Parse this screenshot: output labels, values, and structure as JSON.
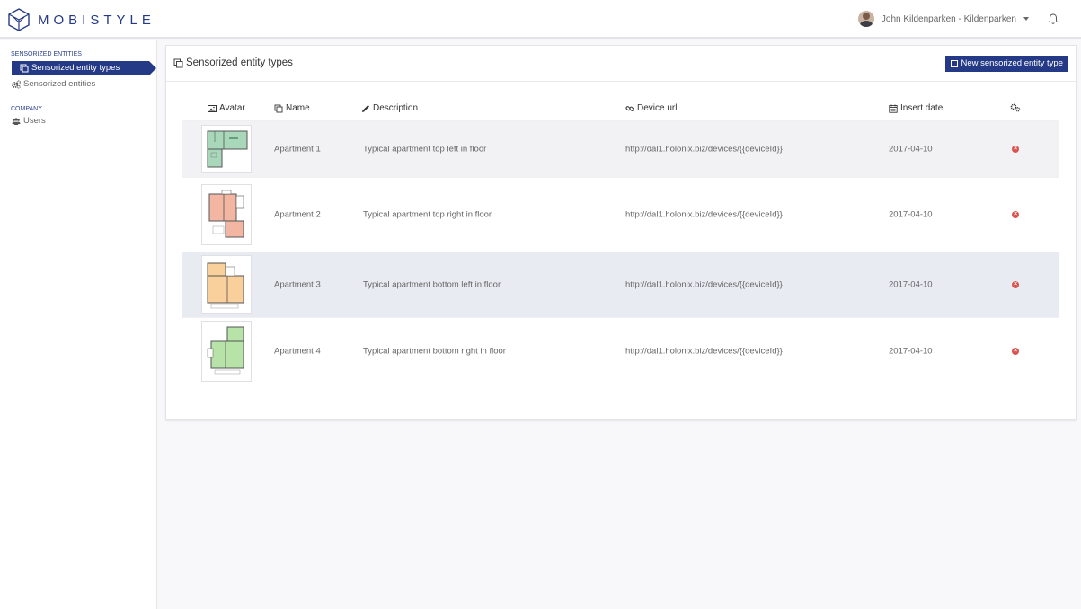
{
  "brand": {
    "name": "MOBISTYLE",
    "color": "#253a86"
  },
  "header": {
    "user_name": "John Kildenparken - Kildenparken",
    "dropdown_icon": "caret-down-icon",
    "notification_icon": "bell-icon"
  },
  "sidebar": {
    "sections": [
      {
        "title": "SENSORIZED ENTITIES"
      },
      {
        "title": "COMPANY"
      }
    ],
    "items": [
      {
        "label": "Sensorized entity types",
        "icon": "copy-icon",
        "active": true
      },
      {
        "label": "Sensorized entities",
        "icon": "cogs-icon",
        "active": false
      },
      {
        "label": "Users",
        "icon": "users-icon",
        "active": false
      }
    ]
  },
  "main": {
    "title": "Sensorized entity types",
    "new_button_label": "New sensorized entity type",
    "columns": {
      "avatar": "Avatar",
      "name": "Name",
      "description": "Description",
      "device_url": "Device url",
      "insert_date": "Insert date",
      "actions_icon": "sitemap-icon"
    },
    "rows": [
      {
        "name": "Apartment 1",
        "description": "Typical apartment top left in floor",
        "device_url": "http://dal1.holonix.biz/devices/{{deviceId}}",
        "insert_date": "2017-04-10",
        "floor_color": "#a8d8b9"
      },
      {
        "name": "Apartment 2",
        "description": "Typical apartment top right in floor",
        "device_url": "http://dal1.holonix.biz/devices/{{deviceId}}",
        "insert_date": "2017-04-10",
        "floor_color": "#f3b6a2"
      },
      {
        "name": "Apartment 3",
        "description": "Typical apartment bottom left in floor",
        "device_url": "http://dal1.holonix.biz/devices/{{deviceId}}",
        "insert_date": "2017-04-10",
        "floor_color": "#f9cf9b"
      },
      {
        "name": "Apartment 4",
        "description": "Typical apartment bottom right in floor",
        "device_url": "http://dal1.holonix.biz/devices/{{deviceId}}",
        "insert_date": "2017-04-10",
        "floor_color": "#b8e3a8"
      }
    ],
    "delete_icon": "times-circle-icon",
    "delete_color": "#d9534f"
  }
}
